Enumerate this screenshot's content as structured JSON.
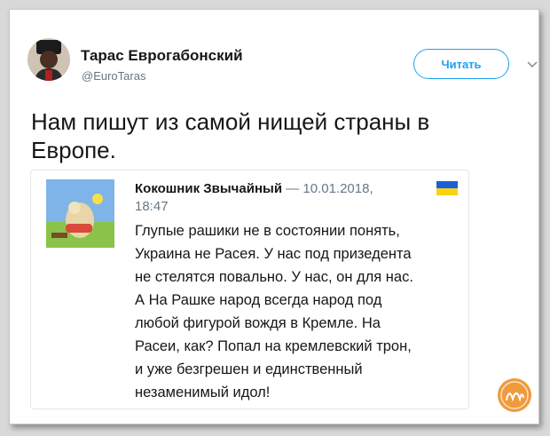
{
  "tweet": {
    "author_name": "Тарас Еврогабонский",
    "author_handle": "@EuroTaras",
    "follow_label": "Читать",
    "text_line1": "Нам пишут из самой нищей страны в",
    "text_line2": "Европе."
  },
  "quoted": {
    "author_name": "Кокошник Звычайный",
    "separator": " — ",
    "date": "10.01.2018,",
    "time": "18:47",
    "lines": [
      "Глупые рашики не в состоянии понять,",
      "Украина не Расея. У нас под призедента",
      "не стелятся повально. У нас, он для нас.",
      "А На Рашке народ всегда народ под",
      "любой фигурой вождя в Кремле. На",
      "Расеи, как? Попал на кремлевский трон,",
      "и уже безгрешен и единственный",
      "незаменимый идол!"
    ]
  },
  "icons": {
    "caret": "chevron-down-icon",
    "flag": "ukraine-flag-icon",
    "watermark": "site-logo-icon"
  },
  "colors": {
    "accent": "#1da1f2",
    "secondary_text": "#657786",
    "primary_text": "#14171a",
    "flag_blue": "#1a5fd6",
    "flag_yellow": "#f7d21a"
  }
}
